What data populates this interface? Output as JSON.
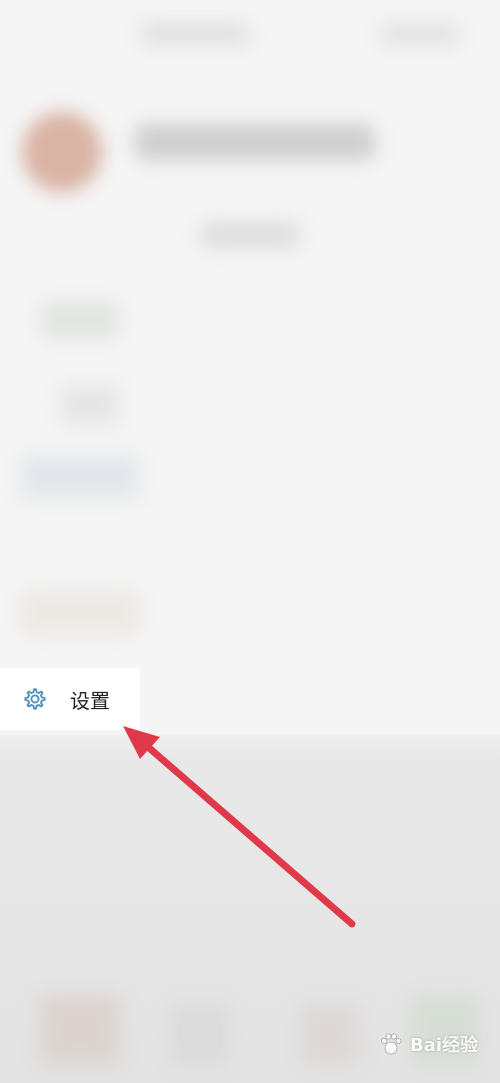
{
  "drawer": {
    "settings_label": "设置",
    "settings_icon": "gear-icon"
  },
  "colors": {
    "accent_icon": "#4a8fc2",
    "annotation_arrow": "#e03a4a"
  },
  "watermark": {
    "text": "Bai经验"
  }
}
